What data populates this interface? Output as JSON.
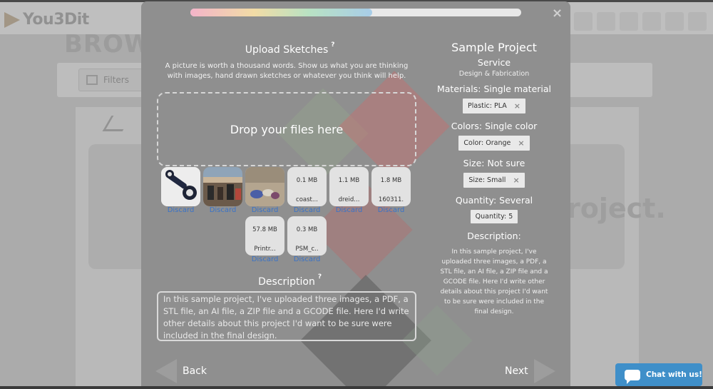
{
  "background_app": {
    "logo_text": "You3Dit",
    "page_title": "BROW",
    "filters_label": "Filters",
    "project_word": "roject."
  },
  "modal": {
    "progress_percent": 55,
    "upload": {
      "title": "Upload Sketches",
      "help_mark": "?",
      "subtitle": "A picture is worth a thousand words. Show us what you are thinking with images, hand drawn sketches or whatever you think will help.",
      "dropzone_text": "Drop your files here"
    },
    "files": [
      {
        "kind": "image",
        "thumb": "part",
        "discard": "Discard"
      },
      {
        "kind": "image",
        "thumb": "workshop",
        "discard": "Discard"
      },
      {
        "kind": "image",
        "thumb": "objects",
        "discard": "Discard"
      },
      {
        "kind": "file",
        "size": "0.1 MB",
        "name": "coast...",
        "discard": "Discard"
      },
      {
        "kind": "file",
        "size": "1.1 MB",
        "name": "dreid...",
        "discard": "Discard"
      },
      {
        "kind": "file",
        "size": "1.8 MB",
        "name": "160311.",
        "discard": "Discard"
      },
      {
        "kind": "file",
        "size": "57.8 MB",
        "name": "Printr...",
        "discard": "Discard"
      },
      {
        "kind": "file",
        "size": "0.3 MB",
        "name": "PSM_c..",
        "discard": "Discard"
      }
    ],
    "description": {
      "title": "Description",
      "help_mark": "?",
      "value": "In this sample project, I've uploaded three images, a PDF, a STL file, an AI file, a ZIP file and a GCODE file. Here I'd write other details about this project I'd want to be sure were included in the final design."
    },
    "nav": {
      "back_label": "Back",
      "next_label": "Next"
    },
    "summary": {
      "title": "Sample Project",
      "service_label": "Service",
      "service_value": "Design & Fabrication",
      "materials_label": "Materials: Single material",
      "materials_chip": "Plastic: PLA",
      "colors_label": "Colors: Single color",
      "colors_chip": "Color: Orange",
      "size_label": "Size: Not sure",
      "size_chip": "Size: Small",
      "quantity_label": "Quantity: Several",
      "quantity_chip": "Quantity: 5",
      "description_label": "Description:",
      "description_value": "In this sample project, I've uploaded three images, a PDF, a STL file, an AI file, a ZIP file and a GCODE file. Here I'd write other details about this project I'd want to be sure were included in the final design.",
      "chip_remove": "×"
    },
    "close_glyph": "×"
  },
  "chat": {
    "label": "Chat with us!"
  },
  "colors": {
    "link": "#3a73c7",
    "chat_bg": "#3f8fc9",
    "modal_bg": "#8f8f8f"
  }
}
